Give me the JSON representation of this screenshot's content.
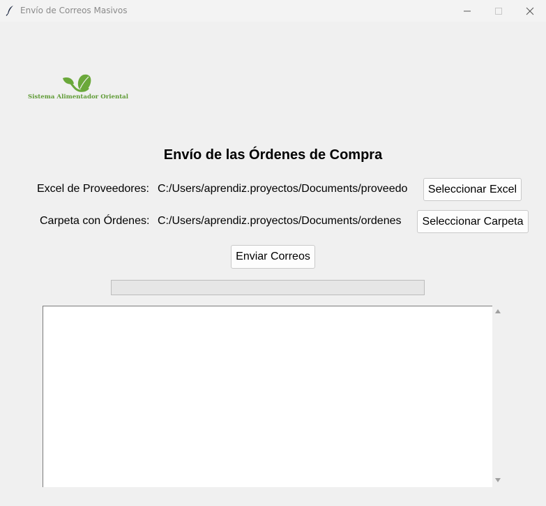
{
  "window": {
    "title": "Envío de Correos Masivos",
    "icon": "feather-icon"
  },
  "logo": {
    "text": "Sistema Alimentador Oriental",
    "icon": "leaf-logo-icon",
    "color": "#5f9b36"
  },
  "heading": "Envío de las Órdenes de Compra",
  "excel": {
    "label": "Excel de Proveedores:",
    "path": "C:/Users/aprendiz.proyectos/Documents/proveedores",
    "button": "Seleccionar Excel"
  },
  "folder": {
    "label": "Carpeta con Órdenes:",
    "path": "C:/Users/aprendiz.proyectos/Documents/ordenes",
    "button": "Seleccionar Carpeta"
  },
  "send_button": "Enviar Correos",
  "progress": {
    "value": 0
  },
  "log": {
    "text": ""
  }
}
